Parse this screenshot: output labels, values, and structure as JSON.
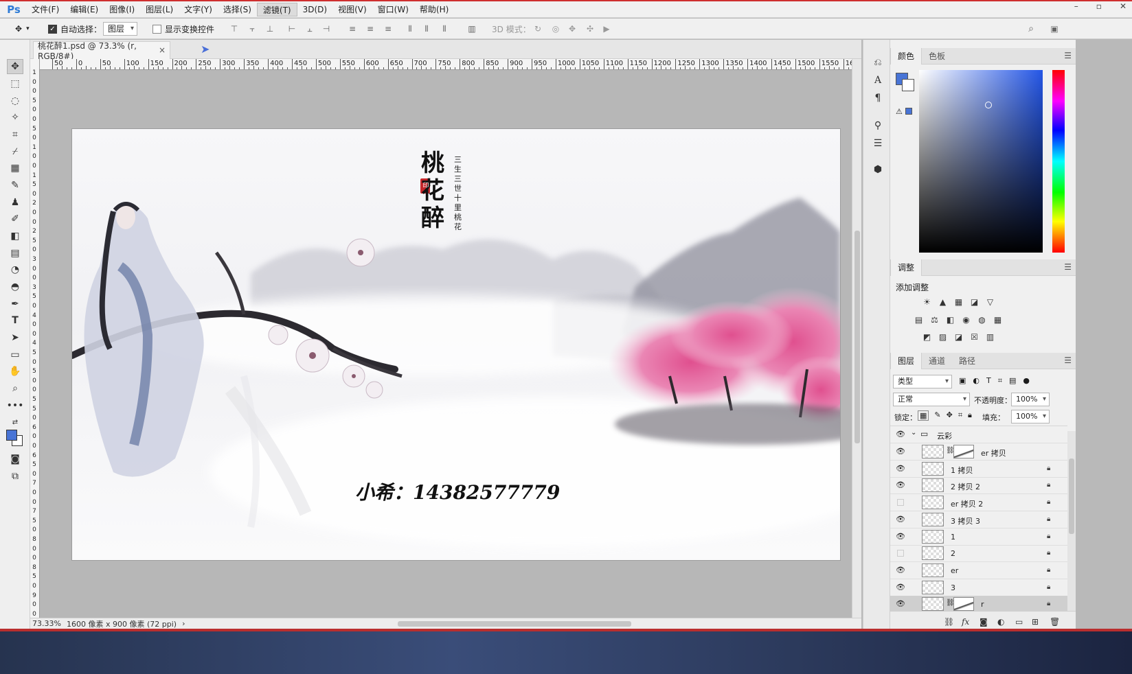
{
  "app": {
    "logo": "Ps"
  },
  "menu": [
    "文件(F)",
    "编辑(E)",
    "图像(I)",
    "图层(L)",
    "文字(Y)",
    "选择(S)",
    "滤镜(T)",
    "3D(D)",
    "视图(V)",
    "窗口(W)",
    "帮助(H)"
  ],
  "window_controls": [
    "–",
    "▫",
    "✕"
  ],
  "options": {
    "auto_select_label": "自动选择：",
    "auto_select_value": "图层",
    "show_transform_label": "显示变换控件",
    "mode_3d_label": "3D 模式："
  },
  "document": {
    "tab_title": "桃花醉1.psd @ 73.3% (r, RGB/8#)",
    "close": "×"
  },
  "ruler_h": [
    "50",
    "0",
    "50",
    "100",
    "150",
    "200",
    "250",
    "300",
    "350",
    "400",
    "450",
    "500",
    "550",
    "600",
    "650",
    "700",
    "750",
    "800",
    "850",
    "900",
    "950",
    "1000",
    "1050",
    "1100",
    "1150",
    "1200",
    "1250",
    "1300",
    "1350",
    "1400",
    "1450",
    "1500",
    "1550",
    "160"
  ],
  "ruler_v": [
    "1",
    "0",
    "0",
    "5",
    "0",
    "0",
    "5",
    "0",
    "1",
    "0",
    "0",
    "1",
    "5",
    "0",
    "2",
    "0",
    "0",
    "2",
    "5",
    "0",
    "3",
    "0",
    "0",
    "3",
    "5",
    "0",
    "4",
    "0",
    "0",
    "4",
    "5",
    "0",
    "5",
    "0",
    "0",
    "5",
    "5",
    "0",
    "6",
    "0",
    "0",
    "6",
    "5",
    "0",
    "7",
    "0",
    "0",
    "7",
    "5",
    "0",
    "8",
    "0",
    "0",
    "8",
    "5",
    "0",
    "9",
    "0",
    "0"
  ],
  "artwork": {
    "title_chars": [
      "桃",
      "花",
      "醉"
    ],
    "subtitle_col1": "三生三世",
    "subtitle_col2": "十里桃花",
    "seal": "印",
    "contact": "小希：14382577779"
  },
  "status": {
    "zoom": "73.33%",
    "doc_info": "1600 像素 x 900 像素 (72 ppi)",
    "arrow": "›"
  },
  "color_panel": {
    "tabs": [
      "颜色",
      "色板"
    ]
  },
  "adjust_panel": {
    "tab": "调整",
    "add_label": "添加调整"
  },
  "layers_panel": {
    "tabs": [
      "图层",
      "通道",
      "路径"
    ],
    "filter_kind": "类型",
    "blend_mode": "正常",
    "opacity_label": "不透明度：",
    "opacity_value": "100%",
    "lock_label": "锁定：",
    "fill_label": "填充：",
    "fill_value": "100%",
    "group_name": "云彩",
    "layers": [
      {
        "name": "er 拷贝",
        "visible": true,
        "mask": true,
        "locked": false
      },
      {
        "name": "1 拷贝",
        "visible": true,
        "mask": false,
        "locked": true
      },
      {
        "name": "2 拷贝 2",
        "visible": true,
        "mask": false,
        "locked": true
      },
      {
        "name": "er 拷贝 2",
        "visible": false,
        "mask": false,
        "locked": true
      },
      {
        "name": "3 拷贝 3",
        "visible": true,
        "mask": false,
        "locked": true
      },
      {
        "name": "1",
        "visible": true,
        "mask": false,
        "locked": true
      },
      {
        "name": "2",
        "visible": false,
        "mask": false,
        "locked": true
      },
      {
        "name": "er",
        "visible": true,
        "mask": false,
        "locked": true
      },
      {
        "name": "3",
        "visible": true,
        "mask": false,
        "locked": true
      },
      {
        "name": "r",
        "visible": true,
        "mask": true,
        "locked": true
      }
    ]
  },
  "colors": {
    "foreground": "#4874d6",
    "background": "#ffffff",
    "accent": "#cf2f2f"
  }
}
